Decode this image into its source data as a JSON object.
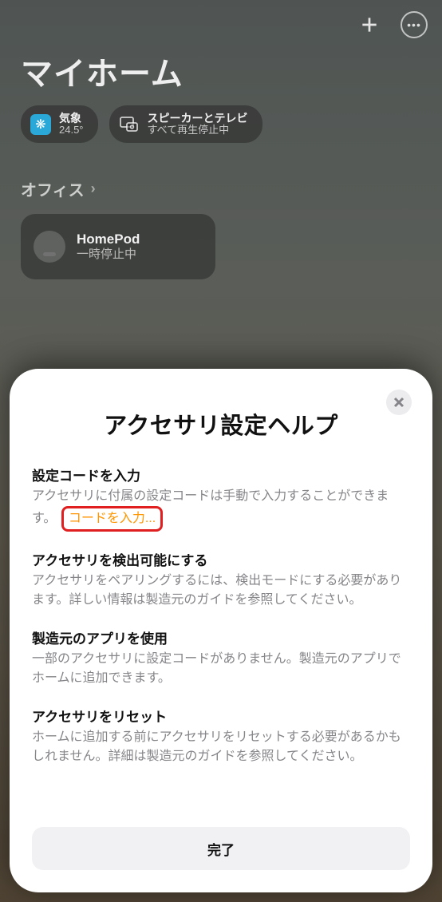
{
  "header": {
    "title": "マイホーム"
  },
  "chips": {
    "weather": {
      "title": "気象",
      "value": "24.5°"
    },
    "speaker": {
      "title": "スピーカーとテレビ",
      "sub": "すべて再生停止中"
    }
  },
  "section": {
    "name": "オフィス"
  },
  "tile": {
    "title": "HomePod",
    "sub": "一時停止中"
  },
  "sheet": {
    "title": "アクセサリ設定ヘルプ",
    "s1_head": "設定コードを入力",
    "s1_body_a": "アクセサリに付属の設定コードは手動で入力することができます。",
    "s1_link": "コードを入力...",
    "s2_head": "アクセサリを検出可能にする",
    "s2_body": "アクセサリをペアリングするには、検出モードにする必要があります。詳しい情報は製造元のガイドを参照してください。",
    "s3_head": "製造元のアプリを使用",
    "s3_body": "一部のアクセサリに設定コードがありません。製造元のアプリでホームに追加できます。",
    "s4_head": "アクセサリをリセット",
    "s4_body": "ホームに追加する前にアクセサリをリセットする必要があるかもしれません。詳細は製造元のガイドを参照してください。",
    "done": "完了"
  }
}
